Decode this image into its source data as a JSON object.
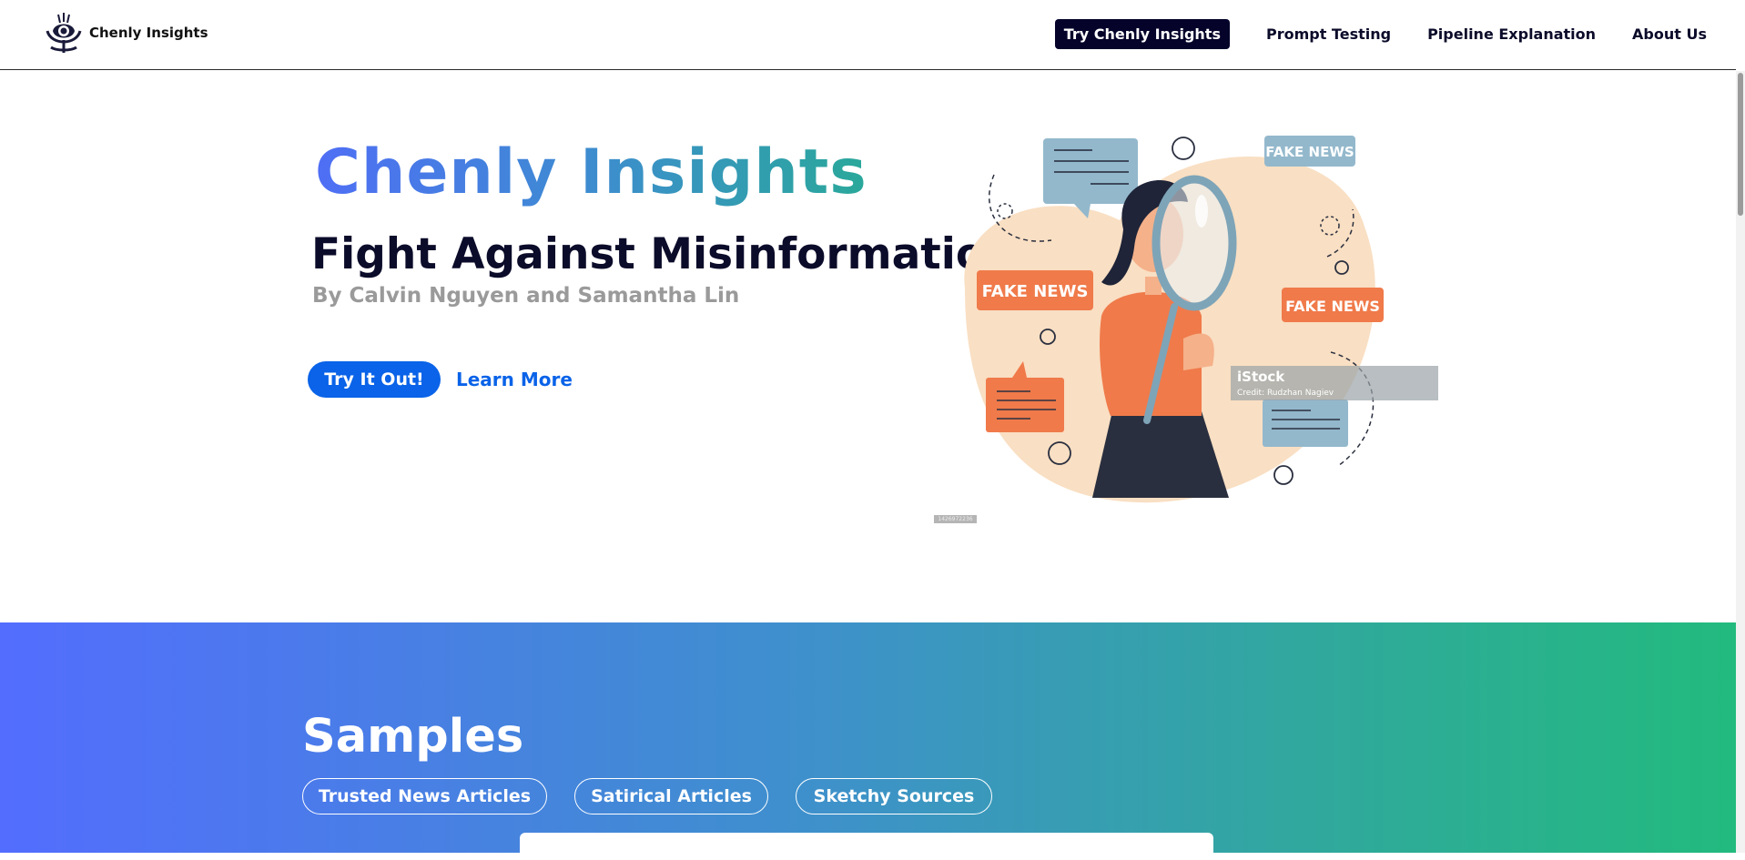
{
  "header": {
    "brand_name": "Chenly Insights",
    "nav": {
      "cta_label": "Try Chenly Insights",
      "prompt_testing": "Prompt Testing",
      "pipeline_explanation": "Pipeline Explanation",
      "about_us": "About Us"
    }
  },
  "hero": {
    "title": "Chenly Insights",
    "subtitle": "Fight Against Misinformation",
    "authors": "By Calvin Nguyen and Samantha Lin",
    "primary_button": "Try It Out!",
    "secondary_link": "Learn More",
    "illustration": {
      "labels": [
        "FAKE NEWS",
        "FAKE NEWS",
        "FAKE NEWS"
      ],
      "watermark_brand": "iStock",
      "watermark_credit": "Credit: Rudzhan Nagiev",
      "image_id": "1426972236"
    }
  },
  "samples": {
    "title": "Samples",
    "tabs": [
      "Trusted News Articles",
      "Satirical Articles",
      "Sketchy Sources"
    ]
  },
  "colors": {
    "primary_blue": "#0a63e8",
    "navy": "#05032a",
    "gradient_start": "#536dfe",
    "gradient_end": "#22ba7e",
    "illustration_orange": "#f07a4a",
    "illustration_peach": "#f9dfc3",
    "illustration_blue": "#93b8cc"
  }
}
